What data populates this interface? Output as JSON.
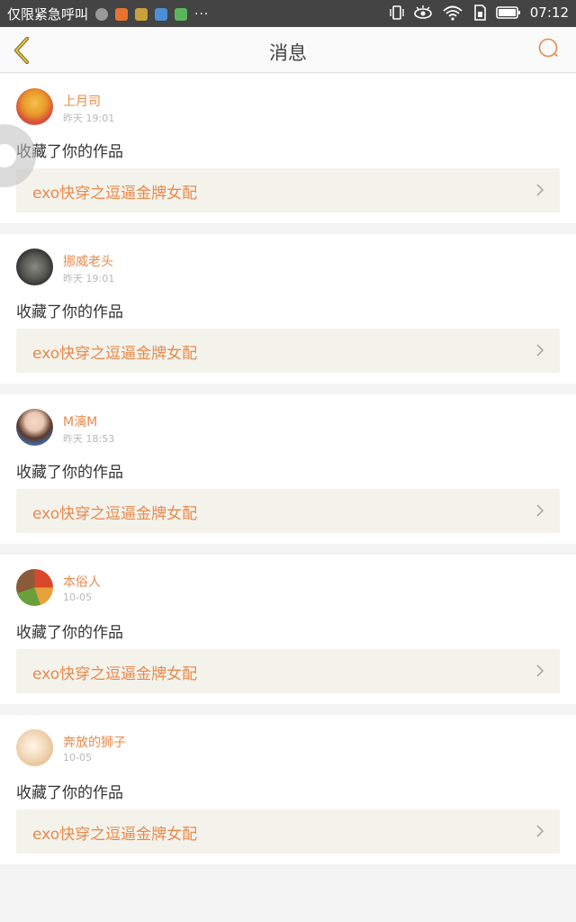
{
  "status_bar": {
    "carrier_text": "仅限紧急呼叫",
    "more": "···",
    "time": "07:12"
  },
  "header": {
    "title": "消息"
  },
  "messages": [
    {
      "user": "上月司",
      "time": "昨天 19:01",
      "action": "收藏了你的作品",
      "work_title": "exo快穿之逗逼金牌女配"
    },
    {
      "user": "挪威老头",
      "time": "昨天 19:01",
      "action": "收藏了你的作品",
      "work_title": "exo快穿之逗逼金牌女配"
    },
    {
      "user": "M漓M",
      "time": "昨天 18:53",
      "action": "收藏了你的作品",
      "work_title": "exo快穿之逗逼金牌女配"
    },
    {
      "user": "本俗人",
      "time": "10-05",
      "action": "收藏了你的作品",
      "work_title": "exo快穿之逗逼金牌女配"
    },
    {
      "user": "奔放的狮子",
      "time": "10-05",
      "action": "收藏了你的作品",
      "work_title": "exo快穿之逗逼金牌女配"
    }
  ],
  "colors": {
    "accent": "#e8894c",
    "status_bar_bg": "#444444",
    "work_bg": "#f3f3ec"
  }
}
